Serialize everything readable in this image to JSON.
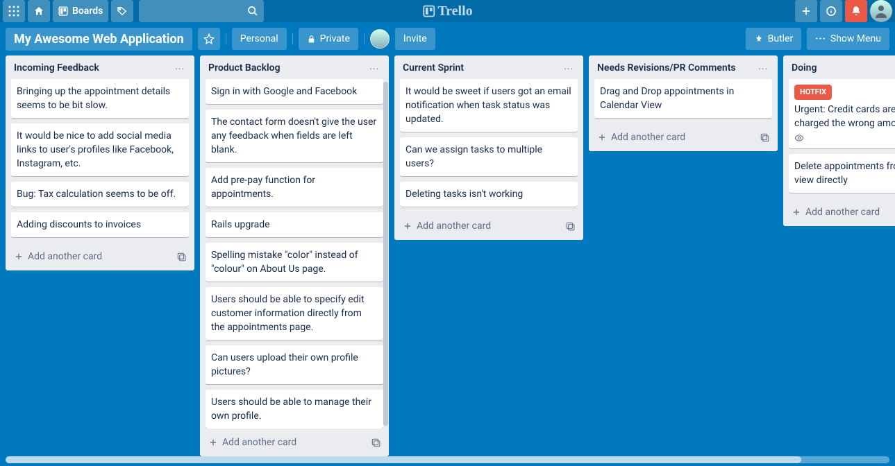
{
  "header": {
    "boards_label": "Boards",
    "search_placeholder": "",
    "logo_text": "Trello"
  },
  "board_header": {
    "board_name": "My Awesome Web Application",
    "workspace_label": "Personal",
    "visibility_label": "Private",
    "invite_label": "Invite",
    "butler_label": "Butler",
    "show_menu_label": "Show Menu"
  },
  "lists": [
    {
      "title": "Incoming Feedback",
      "add_label": "Add another card",
      "scrollable": false,
      "cards": [
        {
          "text": "Bringing up the appointment details seems to be bit slow."
        },
        {
          "text": "It would be nice to add social media links to user's profiles like Facebook, Instagram, etc."
        },
        {
          "text": "Bug: Tax calculation seems to be off."
        },
        {
          "text": "Adding discounts to invoices"
        }
      ]
    },
    {
      "title": "Product Backlog",
      "add_label": "Add another card",
      "scrollable": true,
      "cards": [
        {
          "text": "Sign in with Google and Facebook"
        },
        {
          "text": "The contact form doesn't give the user any feedback when fields are left blank."
        },
        {
          "text": "Add pre-pay function for appointments."
        },
        {
          "text": "Rails upgrade"
        },
        {
          "text": "Spelling mistake \"color\" instead of \"colour\" on About Us page."
        },
        {
          "text": "Users should be able to specify edit customer information directly from the appointments page."
        },
        {
          "text": "Can users upload their own profile pictures?"
        },
        {
          "text": "Users should be able to manage their own profile."
        }
      ]
    },
    {
      "title": "Current Sprint",
      "add_label": "Add another card",
      "scrollable": false,
      "cards": [
        {
          "text": "It would be sweet if users got an email notification when task status was updated."
        },
        {
          "text": "Can we assign tasks to multiple users?"
        },
        {
          "text": "Deleting tasks isn't working"
        }
      ]
    },
    {
      "title": "Needs Revisions/PR Comments",
      "add_label": "Add another card",
      "scrollable": false,
      "cards": [
        {
          "text": "Drag and Drop appointments in Calendar View"
        }
      ]
    },
    {
      "title": "Doing",
      "add_label": "Add another card",
      "scrollable": false,
      "cards": [
        {
          "label": "HOTFIX",
          "text": "Urgent: Credit cards are getting charged the wrong amount.",
          "watch": true
        },
        {
          "text": "Delete appointments from Calendar view directly"
        }
      ]
    }
  ]
}
